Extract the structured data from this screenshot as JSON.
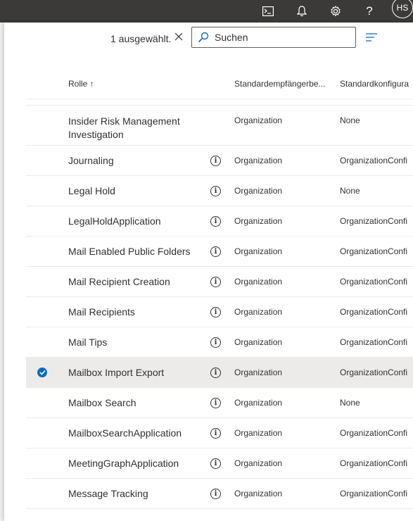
{
  "topbar": {
    "icons": [
      "terminal-icon",
      "bell-icon",
      "gear-icon",
      "help-icon"
    ],
    "help_label": "?",
    "avatar_initials": "HS"
  },
  "toolbar": {
    "selection_count": "1 ausgewählt.",
    "search_placeholder": "Suchen"
  },
  "table": {
    "headers": {
      "role": "Rolle ↑",
      "col1": "Standardempfängerbe...",
      "col2": "Standardkonfigura"
    },
    "rows": [
      {
        "name": "Insider Risk Management Investigation",
        "c1": "Organization",
        "c2": "None",
        "info": false,
        "selected": false
      },
      {
        "name": "Journaling",
        "c1": "Organization",
        "c2": "OrganizationConfi",
        "info": true,
        "selected": false
      },
      {
        "name": "Legal Hold",
        "c1": "Organization",
        "c2": "None",
        "info": true,
        "selected": false
      },
      {
        "name": "LegalHoldApplication",
        "c1": "Organization",
        "c2": "OrganizationConfi",
        "info": true,
        "selected": false
      },
      {
        "name": "Mail Enabled Public Folders",
        "c1": "Organization",
        "c2": "OrganizationConfi",
        "info": true,
        "selected": false
      },
      {
        "name": "Mail Recipient Creation",
        "c1": "Organization",
        "c2": "OrganizationConfi",
        "info": true,
        "selected": false
      },
      {
        "name": "Mail Recipients",
        "c1": "Organization",
        "c2": "OrganizationConfi",
        "info": true,
        "selected": false
      },
      {
        "name": "Mail Tips",
        "c1": "Organization",
        "c2": "OrganizationConfi",
        "info": true,
        "selected": false
      },
      {
        "name": "Mailbox Import Export",
        "c1": "Organization",
        "c2": "OrganizationConfi",
        "info": true,
        "selected": true
      },
      {
        "name": "Mailbox Search",
        "c1": "Organization",
        "c2": "None",
        "info": true,
        "selected": false
      },
      {
        "name": "MailboxSearchApplication",
        "c1": "Organization",
        "c2": "OrganizationConfi",
        "info": true,
        "selected": false
      },
      {
        "name": "MeetingGraphApplication",
        "c1": "Organization",
        "c2": "OrganizationConfi",
        "info": true,
        "selected": false
      },
      {
        "name": "Message Tracking",
        "c1": "Organization",
        "c2": "OrganizationConfi",
        "info": true,
        "selected": false
      }
    ]
  },
  "colors": {
    "topbar": "#3b3a39",
    "accent": "#0f6cbd",
    "selected_row": "#edebe9"
  }
}
